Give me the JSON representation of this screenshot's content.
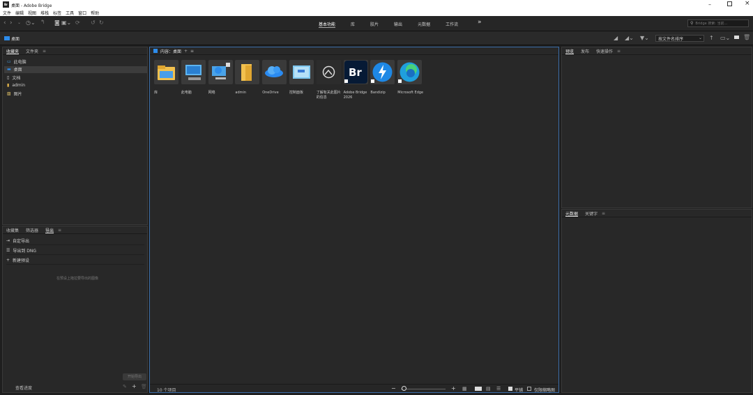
{
  "window": {
    "title": "桌面 - Adobe Bridge",
    "app_icon": "Br"
  },
  "menu": [
    "文件",
    "编辑",
    "视图",
    "堆栈",
    "标签",
    "工具",
    "窗口",
    "帮助"
  ],
  "workspaces": [
    {
      "label": "基本功能",
      "active": true
    },
    {
      "label": "库",
      "active": false
    },
    {
      "label": "胶片",
      "active": false
    },
    {
      "label": "输出",
      "active": false
    },
    {
      "label": "元数据",
      "active": false
    },
    {
      "label": "工作流",
      "active": false
    }
  ],
  "more_glyph": "»",
  "search": {
    "placeholder": "Bridge 搜索: 当前..."
  },
  "path": {
    "label": "桌面"
  },
  "sort": {
    "label": "按文件名排序"
  },
  "left_top_tabs": [
    {
      "label": "收藏夹",
      "active": true
    },
    {
      "label": "文件夹",
      "active": false
    }
  ],
  "favorites": [
    {
      "label": "此电脑",
      "icon": "computer-icon",
      "selected": false
    },
    {
      "label": "桌面",
      "icon": "desktop-icon",
      "selected": true
    },
    {
      "label": "文档",
      "icon": "document-icon",
      "selected": false
    },
    {
      "label": "admin",
      "icon": "user-folder-icon",
      "selected": false
    },
    {
      "label": "图片",
      "icon": "picture-icon",
      "selected": false
    }
  ],
  "left_bottom_tabs": [
    {
      "label": "收藏集",
      "active": false
    },
    {
      "label": "筛选器",
      "active": false
    },
    {
      "label": "导出",
      "active": true
    }
  ],
  "export_items": [
    {
      "label": "自定导出",
      "icon": "export-icon"
    },
    {
      "label": "导出到 DNG",
      "icon": "list-icon"
    },
    {
      "label": "新建预设",
      "icon": "plus-icon"
    }
  ],
  "export_hint": "在预设上拖拉要导出的图像",
  "start_export": "开始导出",
  "view_queue": "查看进度",
  "content": {
    "title": "内容：桌面"
  },
  "items": [
    {
      "label": "库",
      "icon": "library-folder-icon"
    },
    {
      "label": "此电脑",
      "icon": "computer-icon"
    },
    {
      "label": "网络",
      "icon": "network-icon"
    },
    {
      "label": "admin",
      "icon": "folder-icon"
    },
    {
      "label": "OneDrive",
      "icon": "onedrive-icon"
    },
    {
      "label": "控制面板",
      "icon": "control-panel-icon"
    },
    {
      "label": "了解有关此图片的信息",
      "icon": "info-picture-icon"
    },
    {
      "label": "Adobe Bridge 2026",
      "icon": "bridge-icon"
    },
    {
      "label": "Bandizip",
      "icon": "bandizip-icon"
    },
    {
      "label": "Microsoft Edge",
      "icon": "edge-icon"
    }
  ],
  "status": {
    "count": "10 个项目",
    "flat_label": "平铺",
    "cache_label": "仅限缩略图"
  },
  "right_top_tabs": [
    {
      "label": "预览",
      "active": true
    },
    {
      "label": "发布",
      "active": false
    },
    {
      "label": "快速操作",
      "active": false
    }
  ],
  "right_bottom_tabs": [
    {
      "label": "元数据",
      "active": true
    },
    {
      "label": "关键字",
      "active": false
    }
  ],
  "colors": {
    "accent": "#2d8ceb",
    "panel": "#282828",
    "bg": "#1f1f1f"
  }
}
